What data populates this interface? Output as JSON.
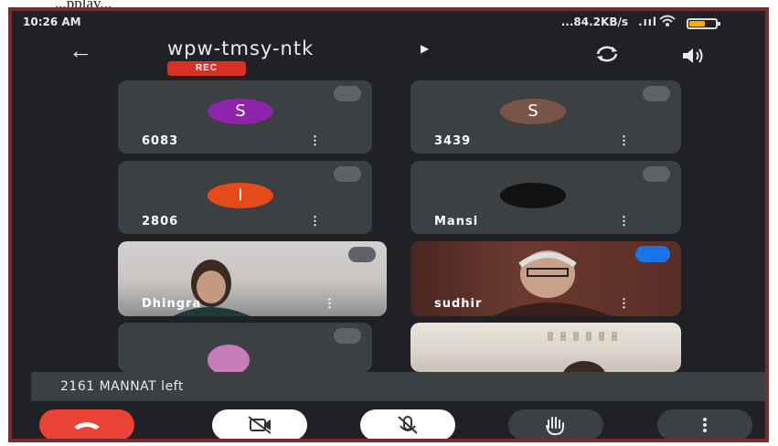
{
  "page_caption": "...pplay...",
  "status_bar": {
    "time": "10:26 AM",
    "network_speed": "...84.2KB/s",
    "signal_text": ".ııl",
    "battery_level": 0.6
  },
  "header": {
    "meeting_code": "wpw-tmsy-ntk",
    "rec_badge": "REC"
  },
  "participants": [
    {
      "name": "6083",
      "avatar_letter": "S",
      "avatar_color": "#8e24aa"
    },
    {
      "name": "3439",
      "avatar_letter": "S",
      "avatar_color": "#795548"
    },
    {
      "name": "2806",
      "avatar_letter": "I",
      "avatar_color": "#e64a19"
    },
    {
      "name": "Mansi",
      "avatar_letter": "",
      "avatar_color": "#111111"
    },
    {
      "name": "Dhingra",
      "avatar_letter": "",
      "avatar_color": ""
    },
    {
      "name": "sudhir",
      "avatar_letter": "",
      "avatar_color": ""
    },
    {
      "name": "",
      "avatar_letter": "",
      "avatar_color": "#c77dbb"
    },
    {
      "name": "",
      "avatar_letter": "",
      "avatar_color": ""
    }
  ],
  "toast": {
    "message": "2161 MANNAT left"
  },
  "colors": {
    "background": "#202124",
    "tile": "#3c4043",
    "end_call": "#ea4335",
    "speaking": "#1a73e8"
  },
  "icons": [
    "back-arrow-icon",
    "switch-camera-icon",
    "speaker-icon",
    "mic-off-icon",
    "more-vert-icon",
    "end-call-icon",
    "camera-off-icon",
    "raise-hand-icon"
  ]
}
